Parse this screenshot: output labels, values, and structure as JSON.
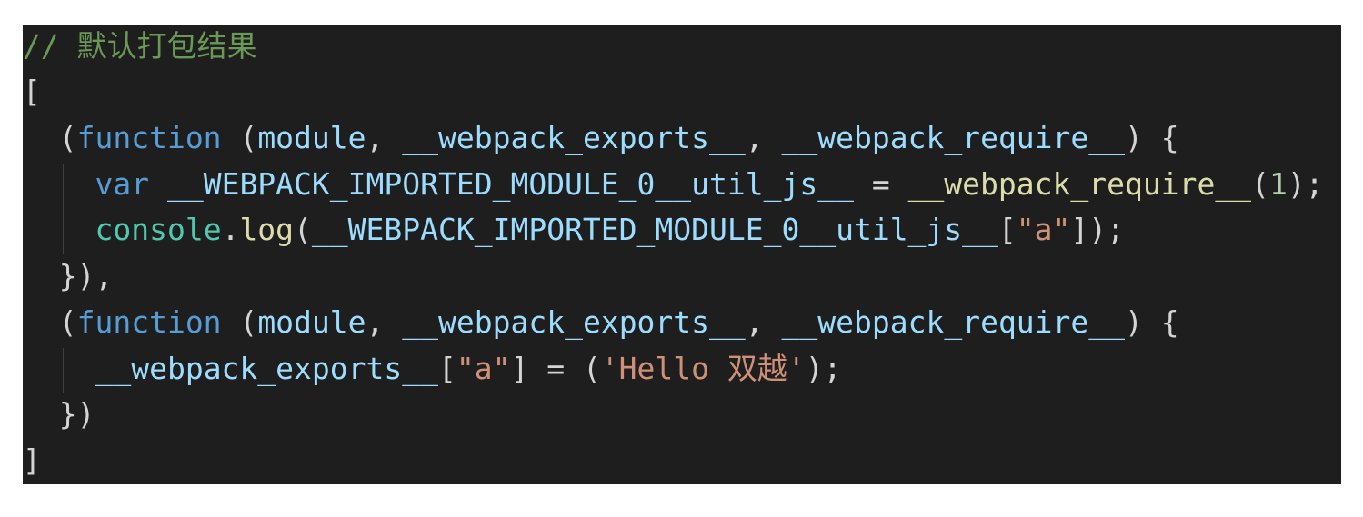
{
  "editor": {
    "language": "javascript",
    "theme_colors": {
      "background": "#1e1e1e",
      "comment": "#6a9955",
      "keyword": "#569cd6",
      "variable": "#9cdcfe",
      "function": "#dcdcaa",
      "number": "#b5cea8",
      "string": "#ce9178",
      "builtin": "#4ec9b0",
      "punctuation": "#d4d4d4"
    },
    "lines": [
      {
        "tokens": [
          {
            "t": "comment",
            "v": "// 默认打包结果"
          }
        ]
      },
      {
        "tokens": [
          {
            "t": "punct",
            "v": "["
          }
        ]
      },
      {
        "tokens": [
          {
            "t": "punct",
            "v": "  ("
          },
          {
            "t": "keyword",
            "v": "function"
          },
          {
            "t": "punct",
            "v": " ("
          },
          {
            "t": "param",
            "v": "module"
          },
          {
            "t": "punct",
            "v": ", "
          },
          {
            "t": "param",
            "v": "__webpack_exports__"
          },
          {
            "t": "punct",
            "v": ", "
          },
          {
            "t": "param",
            "v": "__webpack_require__"
          },
          {
            "t": "punct",
            "v": ") {"
          }
        ]
      },
      {
        "tokens": [
          {
            "t": "punct",
            "v": "    "
          },
          {
            "t": "keyword",
            "v": "var"
          },
          {
            "t": "punct",
            "v": " "
          },
          {
            "t": "param",
            "v": "__WEBPACK_IMPORTED_MODULE_0__util_js__"
          },
          {
            "t": "punct",
            "v": " = "
          },
          {
            "t": "func",
            "v": "__webpack_require__"
          },
          {
            "t": "punct",
            "v": "("
          },
          {
            "t": "number",
            "v": "1"
          },
          {
            "t": "punct",
            "v": ");"
          }
        ]
      },
      {
        "tokens": [
          {
            "t": "punct",
            "v": "    "
          },
          {
            "t": "class",
            "v": "console"
          },
          {
            "t": "punct",
            "v": "."
          },
          {
            "t": "func",
            "v": "log"
          },
          {
            "t": "punct",
            "v": "("
          },
          {
            "t": "param",
            "v": "__WEBPACK_IMPORTED_MODULE_0__util_js__"
          },
          {
            "t": "punct",
            "v": "["
          },
          {
            "t": "string",
            "v": "\"a\""
          },
          {
            "t": "punct",
            "v": "]);"
          }
        ]
      },
      {
        "tokens": [
          {
            "t": "punct",
            "v": "  }),"
          }
        ]
      },
      {
        "tokens": [
          {
            "t": "punct",
            "v": "  ("
          },
          {
            "t": "keyword",
            "v": "function"
          },
          {
            "t": "punct",
            "v": " ("
          },
          {
            "t": "param",
            "v": "module"
          },
          {
            "t": "punct",
            "v": ", "
          },
          {
            "t": "param",
            "v": "__webpack_exports__"
          },
          {
            "t": "punct",
            "v": ", "
          },
          {
            "t": "param",
            "v": "__webpack_require__"
          },
          {
            "t": "punct",
            "v": ") {"
          }
        ]
      },
      {
        "tokens": [
          {
            "t": "punct",
            "v": "    "
          },
          {
            "t": "param",
            "v": "__webpack_exports__"
          },
          {
            "t": "punct",
            "v": "["
          },
          {
            "t": "string",
            "v": "\"a\""
          },
          {
            "t": "punct",
            "v": "] = ("
          },
          {
            "t": "string",
            "v": "'Hello 双越'"
          },
          {
            "t": "punct",
            "v": ");"
          }
        ]
      },
      {
        "tokens": [
          {
            "t": "punct",
            "v": "  })"
          }
        ]
      },
      {
        "tokens": [
          {
            "t": "punct",
            "v": "]"
          }
        ]
      }
    ]
  }
}
